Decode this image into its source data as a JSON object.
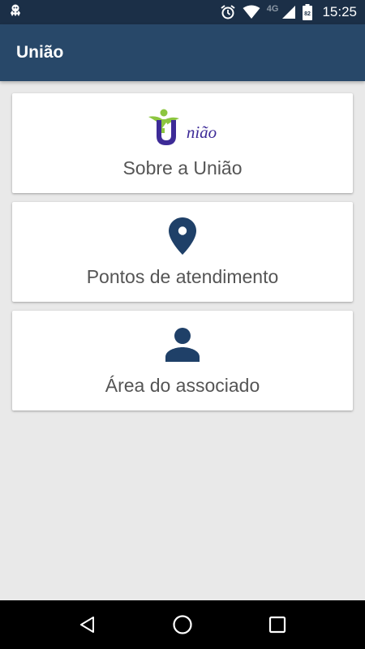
{
  "status_bar": {
    "network_type": "4G",
    "battery_level": "82",
    "time": "15:25",
    "icons": [
      "notification-icon",
      "alarm-icon",
      "wifi-icon",
      "signal-icon",
      "battery-icon"
    ]
  },
  "app_bar": {
    "title": "União"
  },
  "logo": {
    "text": "nião"
  },
  "cards": [
    {
      "label": "Sobre a União",
      "icon": "uniao-logo"
    },
    {
      "label": "Pontos de atendimento",
      "icon": "location-pin-icon"
    },
    {
      "label": "Área do associado",
      "icon": "person-icon"
    }
  ],
  "colors": {
    "status_bar": "#1b2f47",
    "app_bar": "#284869",
    "icon": "#1f4068",
    "background": "#e9e9e9",
    "logo_green": "#8cc63f",
    "logo_purple": "#3d2b97"
  },
  "nav_bar": {
    "icons": [
      "back-icon",
      "home-icon",
      "recents-icon"
    ]
  }
}
